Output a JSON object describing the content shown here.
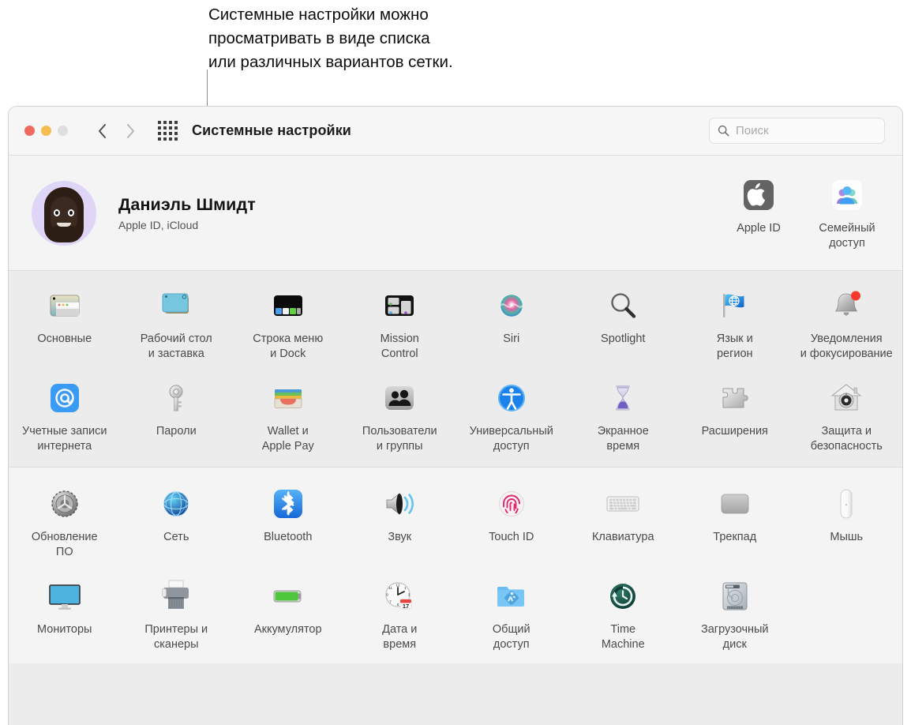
{
  "callout": {
    "text": "Системные настройки можно\nпросматривать в виде списка\nили различных вариантов сетки."
  },
  "window": {
    "title": "Системные настройки",
    "traffic_lights": [
      "close",
      "minimize",
      "zoom"
    ],
    "nav_back": "Назад",
    "nav_forward": "Вперед",
    "grid_view": "Показать все",
    "colors": {
      "close": "#ee6a5f",
      "minimize": "#f5bd4f",
      "zoom": "#dedede",
      "titlebar_bg": "#f6f6f6",
      "section_light": "#f4f4f4",
      "section_mid": "#ececec",
      "label_text": "#4a4a4a"
    }
  },
  "search": {
    "placeholder": "Поиск",
    "value": "",
    "icon": "search-icon"
  },
  "account": {
    "name": "Даниэль Шмидт",
    "subtitle": "Apple ID, iCloud",
    "avatar_icon": "memoji-avatar",
    "items": [
      {
        "label": "Apple ID",
        "icon": "apple-logo-icon"
      },
      {
        "label": "Семейный\nдоступ",
        "icon": "family-sharing-icon"
      }
    ]
  },
  "personal_section": {
    "items": [
      {
        "label": "Основные",
        "icon": "general-icon"
      },
      {
        "label": "Рабочий стол\nи заставка",
        "icon": "desktop-screensaver-icon"
      },
      {
        "label": "Строка меню\nи Dock",
        "icon": "menubar-dock-icon"
      },
      {
        "label": "Mission\nControl",
        "icon": "mission-control-icon"
      },
      {
        "label": "Siri",
        "icon": "siri-icon"
      },
      {
        "label": "Spotlight",
        "icon": "spotlight-icon"
      },
      {
        "label": "Язык и\nрегион",
        "icon": "language-region-icon"
      },
      {
        "label": "Уведомления\nи фокусирование",
        "icon": "notifications-focus-icon"
      },
      {
        "label": "Учетные записи\nинтернета",
        "icon": "internet-accounts-icon"
      },
      {
        "label": "Пароли",
        "icon": "passwords-key-icon"
      },
      {
        "label": "Wallet и\nApple Pay",
        "icon": "wallet-applepay-icon"
      },
      {
        "label": "Пользователи\nи группы",
        "icon": "users-groups-icon"
      },
      {
        "label": "Универсальный\nдоступ",
        "icon": "accessibility-icon"
      },
      {
        "label": "Экранное\nвремя",
        "icon": "screen-time-icon"
      },
      {
        "label": "Расширения",
        "icon": "extensions-puzzle-icon"
      },
      {
        "label": "Защита и\nбезопасность",
        "icon": "security-privacy-icon"
      }
    ]
  },
  "hardware_section": {
    "items": [
      {
        "label": "Обновление\nПО",
        "icon": "software-update-icon"
      },
      {
        "label": "Сеть",
        "icon": "network-globe-icon"
      },
      {
        "label": "Bluetooth",
        "icon": "bluetooth-icon"
      },
      {
        "label": "Звук",
        "icon": "sound-speaker-icon"
      },
      {
        "label": "Touch ID",
        "icon": "touchid-fingerprint-icon"
      },
      {
        "label": "Клавиатура",
        "icon": "keyboard-icon"
      },
      {
        "label": "Трекпад",
        "icon": "trackpad-icon"
      },
      {
        "label": "Мышь",
        "icon": "mouse-icon"
      },
      {
        "label": "Мониторы",
        "icon": "displays-icon"
      },
      {
        "label": "Принтеры и\nсканеры",
        "icon": "printers-scanners-icon"
      },
      {
        "label": "Аккумулятор",
        "icon": "battery-icon"
      },
      {
        "label": "Дата и\nвремя",
        "icon": "date-time-icon"
      },
      {
        "label": "Общий\nдоступ",
        "icon": "sharing-folder-icon"
      },
      {
        "label": "Time\nMachine",
        "icon": "time-machine-icon"
      },
      {
        "label": "Загрузочный\nдиск",
        "icon": "startup-disk-icon"
      }
    ]
  }
}
